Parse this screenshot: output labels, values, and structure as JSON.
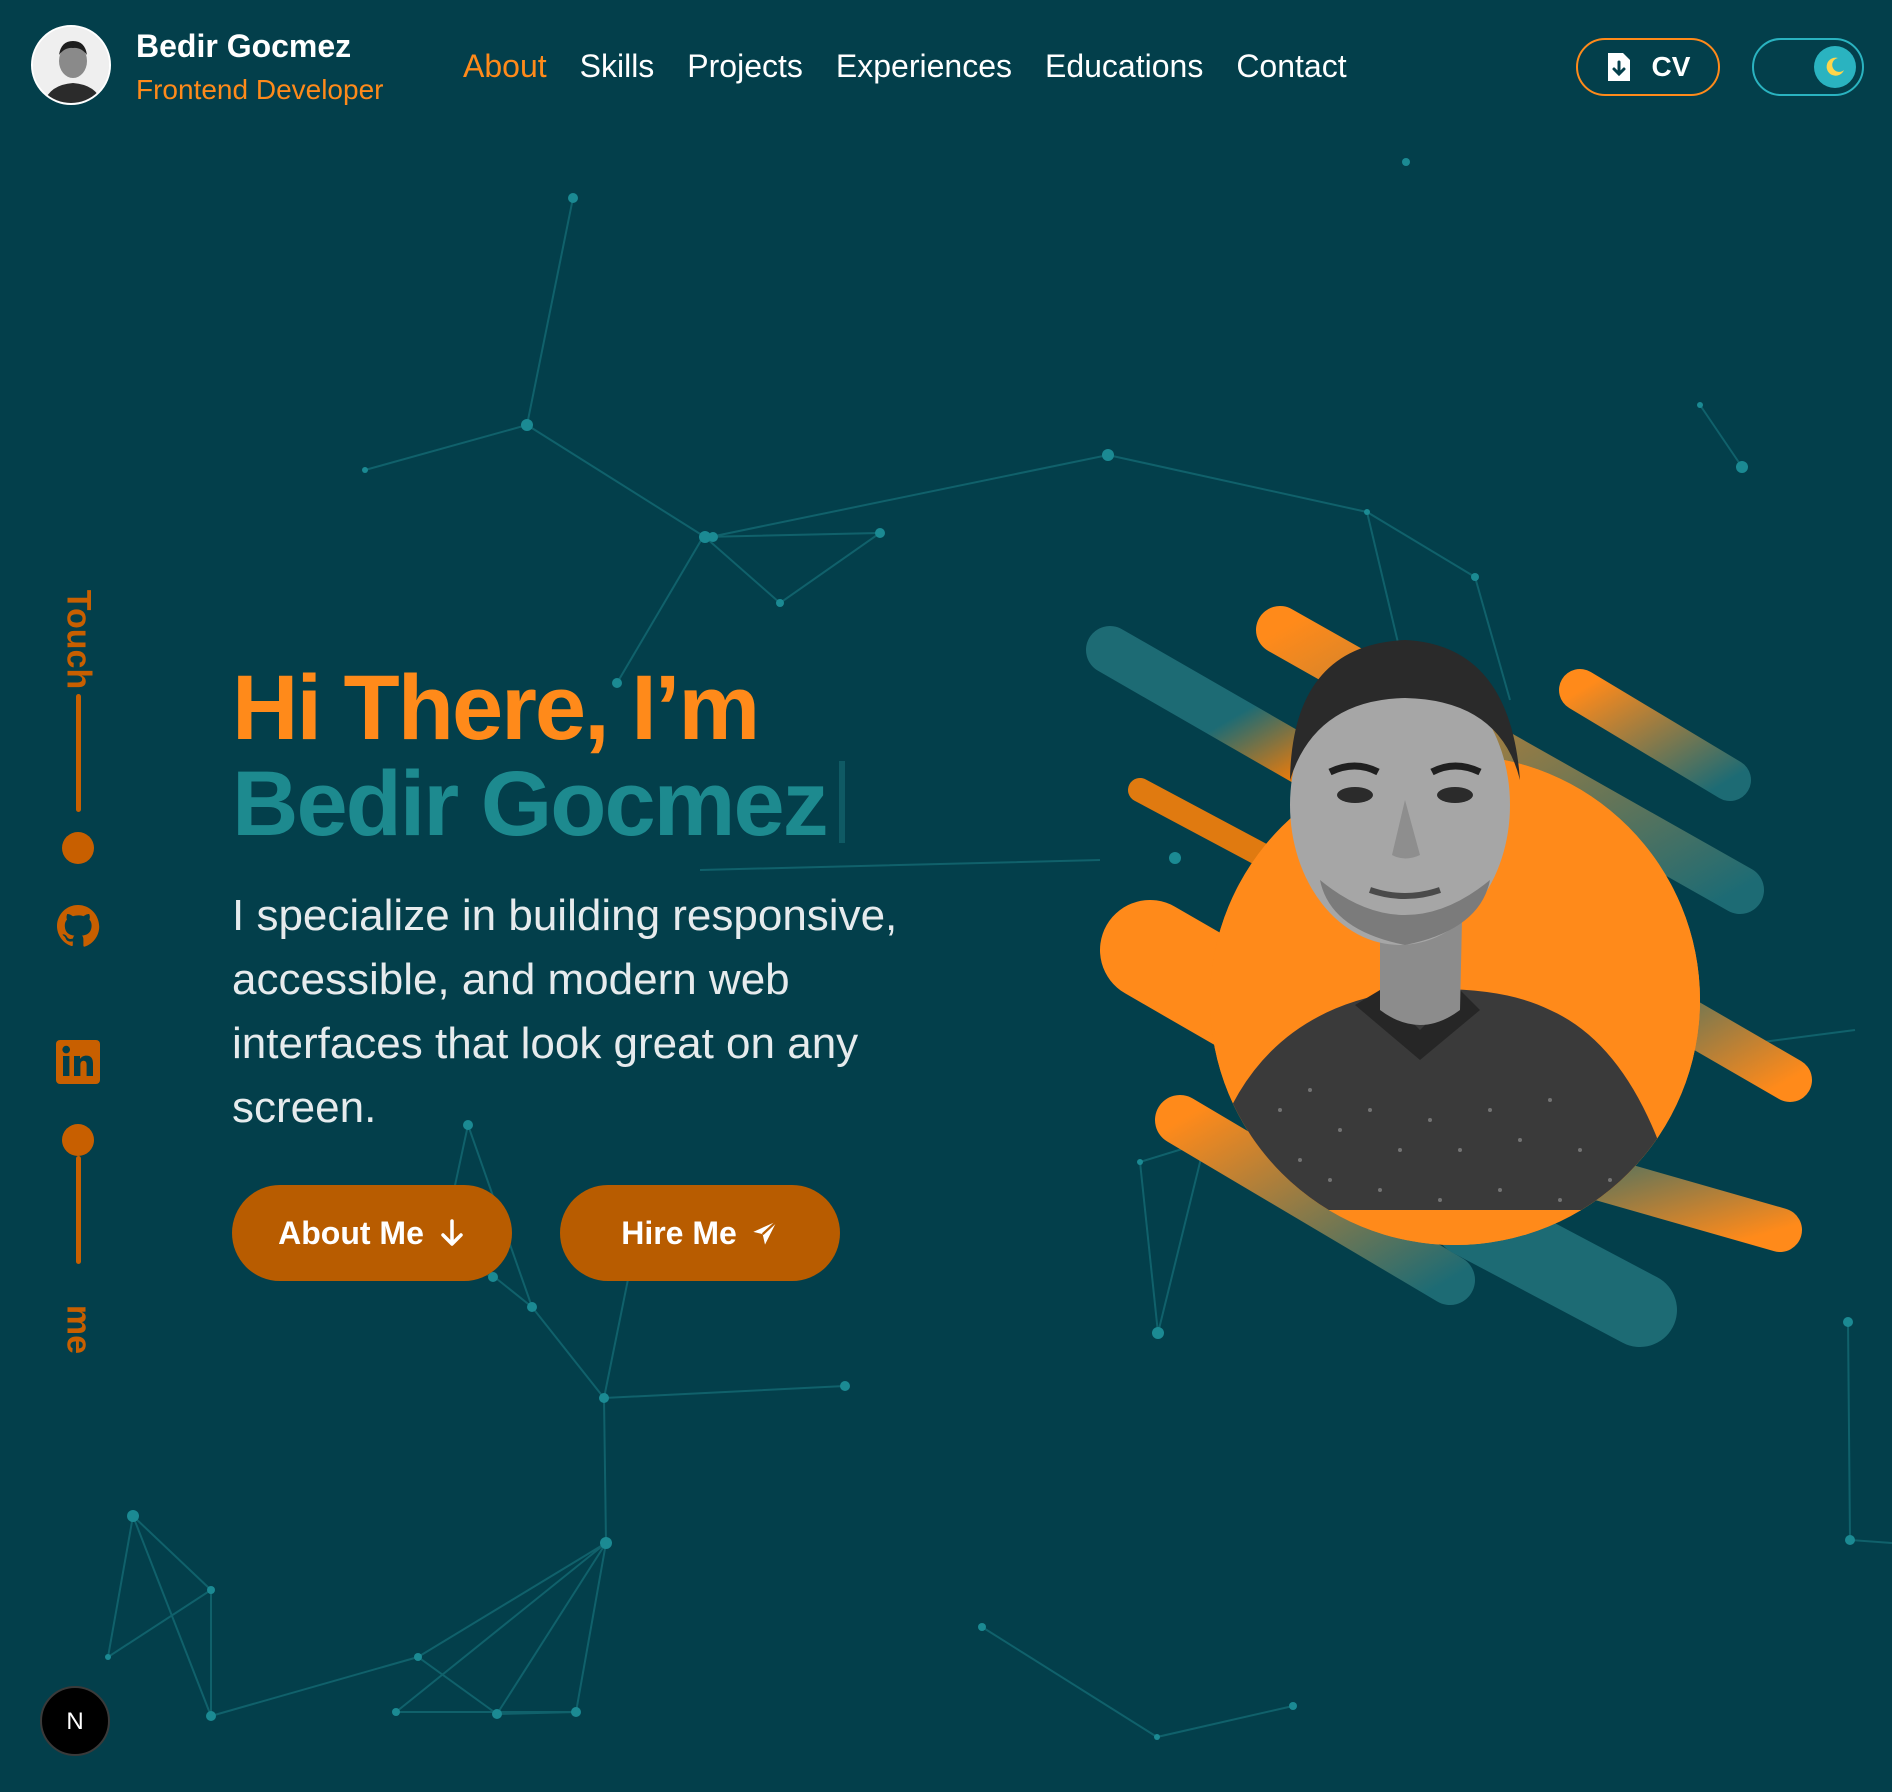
{
  "brand": {
    "name": "Bedir Gocmez",
    "role": "Frontend Developer"
  },
  "nav": {
    "items": [
      "About",
      "Skills",
      "Projects",
      "Experiences",
      "Educations",
      "Contact"
    ],
    "active": "About"
  },
  "header_actions": {
    "cv_label": "CV",
    "cv_icon": "file-download-icon",
    "theme_icon": "moon-icon"
  },
  "side_bar": {
    "top_text": "Touch",
    "bottom_text": "me",
    "icons": [
      "github-icon",
      "linkedin-icon"
    ]
  },
  "hero": {
    "greeting": "Hi There, I’m",
    "name": "Bedir Gocmez",
    "description": "I specialize in building responsive, accessible, and modern web interfaces that look great on any screen.",
    "about_button": "About Me",
    "hire_button": "Hire Me"
  },
  "badge": {
    "letter": "N"
  },
  "colors": {
    "background": "#033f4b",
    "accent": "#ff8a1a",
    "button": "#b85c00",
    "teal": "#1d8a8f"
  }
}
